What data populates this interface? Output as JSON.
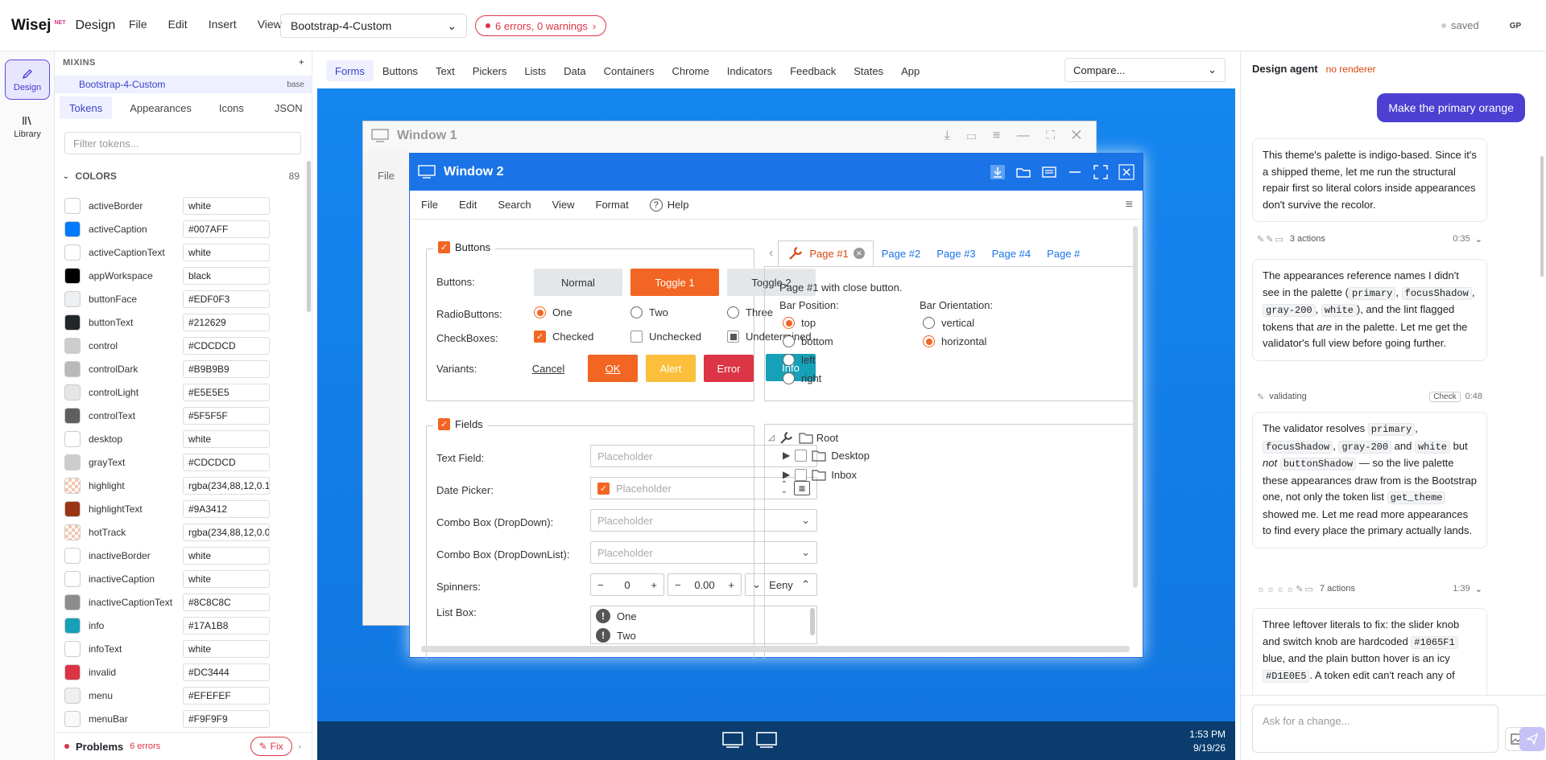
{
  "app": {
    "logo": "Wisej",
    "logo_sup": "NET",
    "section": "Design"
  },
  "top_menu": [
    "File",
    "Edit",
    "Insert",
    "View"
  ],
  "theme_select": "Bootstrap-4-Custom",
  "error_pill": "6 errors, 0 warnings",
  "saved_label": "saved",
  "avatar": "GP",
  "rail": [
    {
      "label": "Design"
    },
    {
      "label": "Library"
    }
  ],
  "mixins": {
    "title": "MIXINS",
    "add": "+",
    "item": "Bootstrap-4-Custom",
    "badge": "base"
  },
  "token_tabs": [
    "Tokens",
    "Appearances",
    "Icons",
    "JSON"
  ],
  "filter_placeholder": "Filter tokens...",
  "colors": {
    "title": "COLORS",
    "count": "89"
  },
  "tokens": [
    {
      "name": "activeBorder",
      "value": "white",
      "color": "#ffffff"
    },
    {
      "name": "activeCaption",
      "value": "#007AFF",
      "color": "#007AFF"
    },
    {
      "name": "activeCaptionText",
      "value": "white",
      "color": "#ffffff"
    },
    {
      "name": "appWorkspace",
      "value": "black",
      "color": "#000000"
    },
    {
      "name": "buttonFace",
      "value": "#EDF0F3",
      "color": "#EDF0F3"
    },
    {
      "name": "buttonText",
      "value": "#212629",
      "color": "#212629"
    },
    {
      "name": "control",
      "value": "#CDCDCD",
      "color": "#CDCDCD"
    },
    {
      "name": "controlDark",
      "value": "#B9B9B9",
      "color": "#B9B9B9"
    },
    {
      "name": "controlLight",
      "value": "#E5E5E5",
      "color": "#E5E5E5"
    },
    {
      "name": "controlText",
      "value": "#5F5F5F",
      "color": "#5F5F5F"
    },
    {
      "name": "desktop",
      "value": "white",
      "color": "#ffffff"
    },
    {
      "name": "grayText",
      "value": "#CDCDCD",
      "color": "#CDCDCD"
    },
    {
      "name": "highlight",
      "value": "rgba(234,88,12,0.1",
      "color": "#fde3d4"
    },
    {
      "name": "highlightText",
      "value": "#9A3412",
      "color": "#9A3412"
    },
    {
      "name": "hotTrack",
      "value": "rgba(234,88,12,0.0",
      "color": "#fdeee6"
    },
    {
      "name": "inactiveBorder",
      "value": "white",
      "color": "#ffffff"
    },
    {
      "name": "inactiveCaption",
      "value": "white",
      "color": "#ffffff"
    },
    {
      "name": "inactiveCaptionText",
      "value": "#8C8C8C",
      "color": "#8C8C8C"
    },
    {
      "name": "info",
      "value": "#17A1B8",
      "color": "#17A1B8"
    },
    {
      "name": "infoText",
      "value": "white",
      "color": "#ffffff"
    },
    {
      "name": "invalid",
      "value": "#DC3444",
      "color": "#DC3444"
    },
    {
      "name": "menu",
      "value": "#EFEFEF",
      "color": "#EFEFEF"
    },
    {
      "name": "menuBar",
      "value": "#F9F9F9",
      "color": "#F9F9F9"
    }
  ],
  "problems": {
    "label": "Problems",
    "count": "6 errors",
    "fix": "Fix"
  },
  "categories": [
    "Forms",
    "Buttons",
    "Text",
    "Pickers",
    "Lists",
    "Data",
    "Containers",
    "Chrome",
    "Indicators",
    "Feedback",
    "States",
    "App"
  ],
  "compare_placeholder": "Compare...",
  "window1": {
    "title": "Window 1",
    "menu": "File"
  },
  "window2": {
    "title": "Window 2",
    "menu": [
      "File",
      "Edit",
      "Search",
      "View",
      "Format",
      "Help"
    ],
    "buttons_group": "Buttons",
    "row_buttons": "Buttons:",
    "btn_normal": "Normal",
    "btn_toggle1": "Toggle 1",
    "btn_toggle2": "Toggle 2",
    "row_radio": "RadioButtons:",
    "radio": [
      "One",
      "Two",
      "Three"
    ],
    "row_check": "CheckBoxes:",
    "checks": [
      "Checked",
      "Unchecked",
      "Undetermined"
    ],
    "row_variants": "Variants:",
    "variants": [
      "Cancel",
      "OK",
      "Alert",
      "Error",
      "Info"
    ],
    "fields_group": "Fields",
    "field_labels": [
      "Text Field:",
      "Date Picker:",
      "Combo Box (DropDown):",
      "Combo Box (DropDownList):",
      "Spinners:",
      "List Box:"
    ],
    "placeholder": "Placeholder",
    "spin1": "0",
    "spin2": "0.00",
    "spin3": "Eeny",
    "list_items": [
      "One",
      "Two"
    ],
    "tabs": [
      "Page #1",
      "Page #2",
      "Page #3",
      "Page #4",
      "Page #"
    ],
    "tab_desc": "Page #1 with close button.",
    "bar_position": "Bar Position:",
    "positions": [
      "top",
      "bottom",
      "left",
      "right"
    ],
    "bar_orientation": "Bar Orientation:",
    "orientations": [
      "vertical",
      "horizontal"
    ],
    "tree": [
      "Root",
      "Desktop",
      "Inbox"
    ]
  },
  "taskbar": {
    "time": "1:53 PM",
    "date": "9/19/26"
  },
  "agent": {
    "title": "Design agent",
    "status": "no renderer",
    "user_msg": "Make the primary orange",
    "m1": "This theme's palette is indigo-based. Since it's a shipped theme, let me run the structural repair first so literal colors inside appearances don't survive the recolor.",
    "a1": {
      "label": "3 actions",
      "time": "0:35"
    },
    "m2_a": "The appearances reference names I didn't see in the palette (",
    "m2_c1": "primary",
    "m2_c2": "focusShadow",
    "m2_c3": "gray-200",
    "m2_c4": "white",
    "m2_b": "), and the lint flagged tokens that ",
    "m2_em": "are",
    "m2_c": " in the palette. Let me get the validator's full view before going further.",
    "a2": {
      "label": "validating",
      "check": "Check",
      "time": "0:48"
    },
    "m3_a": "The validator resolves ",
    "m3_and": " and ",
    "m3_but": " but ",
    "m3_not": "not",
    "m3_c5": "buttonShadow",
    "m3_b": " — so the live palette these appearances draw from is the Bootstrap one, not only the token list ",
    "m3_c6": "get_theme",
    "m3_c": " showed me. Let me read more appearances to find every place the primary actually lands.",
    "a3": {
      "label": "7 actions",
      "time": "1:39"
    },
    "m4_a": "Three leftover literals to fix: the slider knob and switch knob are hardcoded ",
    "m4_c1": "#1065F1",
    "m4_b": " blue, and the plain button hover is an icy ",
    "m4_c2": "#D1E0E5",
    "m4_c": ". A token edit can't reach any of",
    "ask_placeholder": "Ask for a change..."
  }
}
